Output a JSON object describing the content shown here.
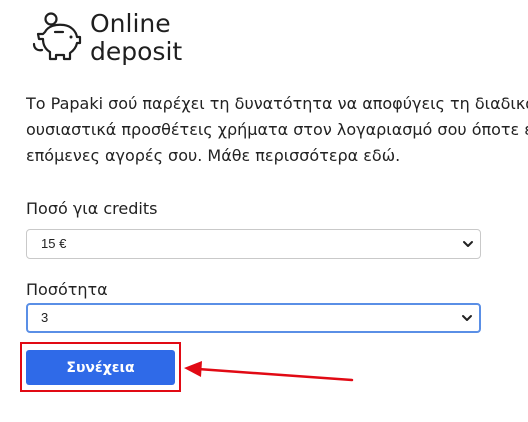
{
  "header": {
    "title_line1": "Online",
    "title_line2": "deposit",
    "icon": "piggy-bank-icon"
  },
  "description": {
    "line1": "Το Papaki σού παρέχει τη δυνατότητα να αποφύγεις τη διαδικα",
    "line2": "ουσιαστικά προσθέτεις χρήματα στον λογαριασμό σου όποτε ετ",
    "line3": "επόμενες αγορές σου. Μάθε περισσότερα εδώ."
  },
  "amount": {
    "label": "Ποσό για credits",
    "selected": "15 €"
  },
  "quantity": {
    "label": "Ποσότητα",
    "selected": "3"
  },
  "continue_button": {
    "label": "Συνέχεια"
  },
  "colors": {
    "button": "#2f6ae8",
    "annotation": "#e10a14",
    "focus_border": "#5a8fe6"
  }
}
